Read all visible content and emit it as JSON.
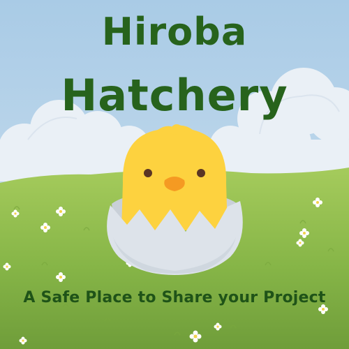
{
  "poster": {
    "title_line_1": "Hiroba",
    "title_line_2": "Hatchery",
    "tagline": "A Safe Place to Share your Project"
  },
  "colors": {
    "sky": "#bcd6ea",
    "cloud": "#eaf0f6",
    "grass_light": "#9fc75a",
    "grass_dark": "#6f9d3a",
    "title_green": "#27631c",
    "chick_yellow": "#fdd23f",
    "beak_orange": "#f59a22",
    "eggshell": "#dde3ea"
  },
  "illustration": {
    "subject": "chick-hatching-from-egg",
    "flowers": "white-daisy-icon"
  }
}
